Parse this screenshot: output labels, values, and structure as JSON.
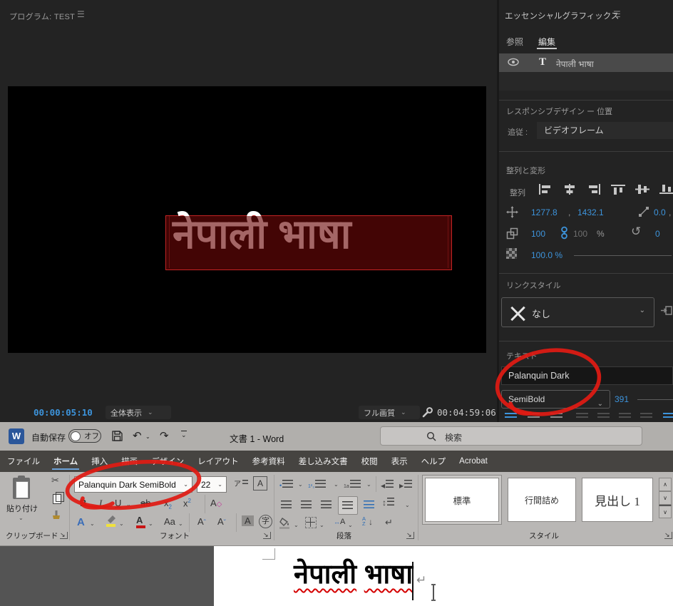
{
  "icons": {
    "hamburger": "☰",
    "chevron_down": "⌄",
    "rotate": "↺",
    "scissors": "✂",
    "undo": "↶",
    "redo": "↷",
    "return_mark": "↵",
    "arrow_up": "∧",
    "arrow_down": "∨",
    "launcher": "↘",
    "comma": ",",
    "updown": "↕",
    "lr_arrows": "↔",
    "caret_hat": "ˆ",
    "caret_chk": "ˇ",
    "down_arrow": "↓",
    "bullet": "•",
    "tri_left": "◀",
    "tri_right": "▶"
  },
  "premiere": {
    "program_monitor": {
      "title": "プログラム: TEST",
      "video_overlay_text": "नेपाली भाषा",
      "current_timecode": "00:00:05:10",
      "zoom_level": "全体表示",
      "playback_quality": "フル画質",
      "end_timecode": "00:04:59:06"
    },
    "essential_graphics": {
      "panel_title": "エッセンシャルグラフィックス",
      "tab_browse": "参照",
      "tab_edit": "編集",
      "layer": {
        "type_glyph": "T",
        "name": "नेपाली भाषा"
      },
      "responsive": {
        "heading": "レスポンシブデザイン ー 位置",
        "follow_label": "追従 :",
        "follow_value": "ビデオフレーム"
      },
      "transform": {
        "heading": "整列と変形",
        "align_label": "整列",
        "position_x": "1277.8",
        "position_y": "1432.1",
        "anchor_x": "0.0",
        "scale": "100",
        "scale_linked": "100",
        "percent_sign": "%",
        "rotation": "0",
        "opacity": "100.0 %"
      },
      "link_style": {
        "heading": "リンクスタイル",
        "value": "なし"
      },
      "text": {
        "heading": "テキスト",
        "font_family": "Palanquin Dark",
        "font_style": "SemiBold",
        "font_size": "391"
      }
    }
  },
  "word": {
    "titlebar": {
      "app_initial": "W",
      "autosave_label": "自動保存",
      "autosave_state": "オフ",
      "document_title": "文書 1  -  Word",
      "search_placeholder": "検索"
    },
    "tabs": [
      "ファイル",
      "ホーム",
      "挿入",
      "描画",
      "デザイン",
      "レイアウト",
      "参考資料",
      "差し込み文書",
      "校閲",
      "表示",
      "ヘルプ",
      "Acrobat"
    ],
    "ribbon": {
      "clipboard": {
        "paste_label": "貼り付け",
        "group_label": "クリップボード"
      },
      "font": {
        "family": "Palanquin Dark SemiBold",
        "size": "22",
        "bold": "B",
        "italic": "I",
        "underline": "U",
        "strikethrough": "ab",
        "subscript_base": "x",
        "subscript_small": "2",
        "superscript_base": "x",
        "superscript_small": "2",
        "phonetic": "ア",
        "char_border": "A",
        "clear_format": "A",
        "text_effects": "A",
        "font_color": "A",
        "change_case": "Aa",
        "grow_font": "A",
        "shrink_font": "A",
        "char_shading": "A",
        "char_width": "字",
        "sort_a": "A",
        "sort_z": "Z",
        "group_label": "フォント"
      },
      "paragraph": {
        "group_label": "段落"
      },
      "styles": {
        "items": [
          "標準",
          "行間詰め",
          "見出し 1"
        ],
        "group_label": "スタイル"
      }
    },
    "document": {
      "text_word1": "नेपाली",
      "text_word2": "भाषा"
    }
  }
}
